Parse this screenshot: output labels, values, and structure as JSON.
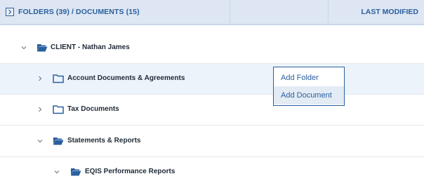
{
  "header": {
    "title": "FOLDERS (39) / DOCUMENTS (15)",
    "last_modified": "LAST MODIFIED",
    "toggle_icon": "chevron-right-box-icon"
  },
  "tree": [
    {
      "label": "CLIENT - Nathan James",
      "expanded": true,
      "icon": "folder-open-icon"
    },
    {
      "label": "Account Documents & Agreements",
      "expanded": false,
      "icon": "folder-icon"
    },
    {
      "label": "Tax Documents",
      "expanded": false,
      "icon": "folder-icon"
    },
    {
      "label": "Statements & Reports",
      "expanded": true,
      "icon": "folder-open-icon"
    },
    {
      "label": "EQIS Performance Reports",
      "expanded": true,
      "icon": "folder-open-icon"
    }
  ],
  "context_menu": {
    "items": [
      "Add Folder",
      "Add Document"
    ]
  },
  "colors": {
    "accent": "#2a5f9e",
    "header_bg": "#dde6f2",
    "highlight_row": "#edf3fb"
  }
}
